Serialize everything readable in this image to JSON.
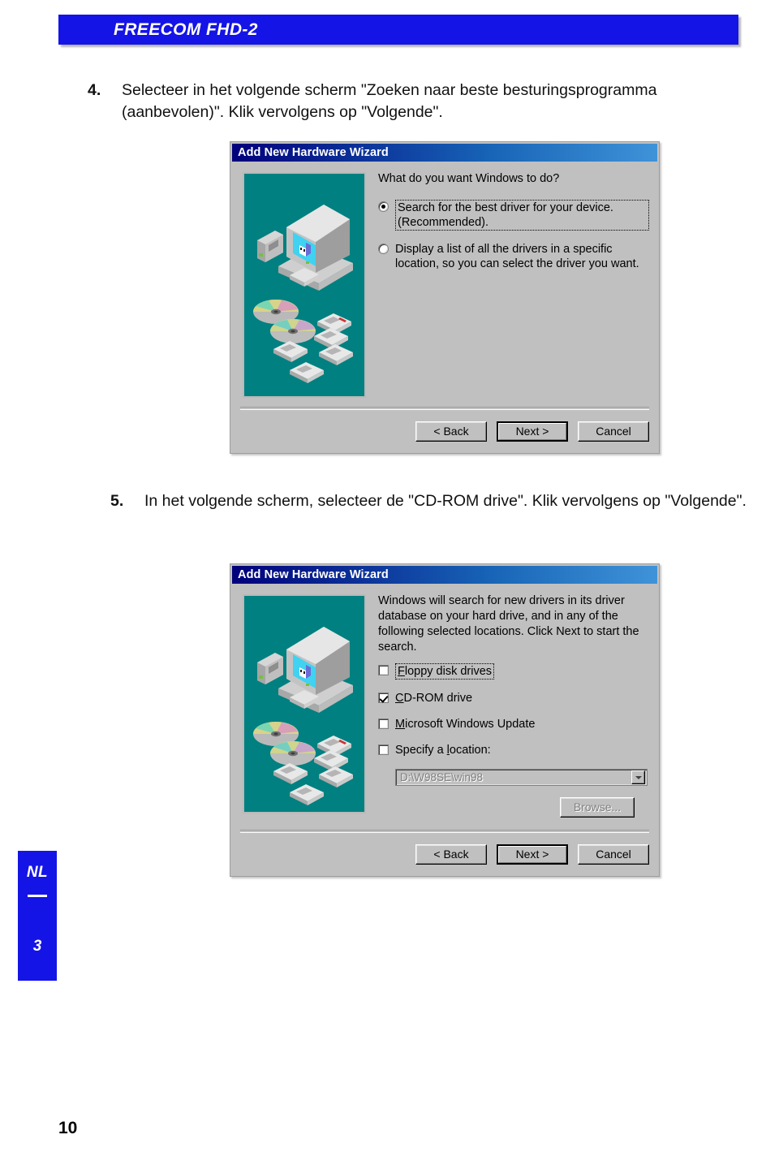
{
  "header": {
    "title": "FREECOM FHD-2"
  },
  "side_tab": {
    "language": "NL",
    "section": "3"
  },
  "page_number": "10",
  "steps": [
    {
      "number": "4.",
      "text": "Selecteer in het volgende scherm \"Zoeken naar beste besturingsprogramma (aanbevolen)\". Klik vervolgens op \"Volgende\"."
    },
    {
      "number": "5.",
      "text": "In het volgende scherm, selecteer de \"CD-ROM drive\". Klik vervolgens op \"Volgende\"."
    }
  ],
  "dialog1": {
    "title": "Add New Hardware Wizard",
    "prompt": "What do you want Windows to do?",
    "options": [
      {
        "label": "Search for the best driver for your device. (Recommended).",
        "selected": true,
        "focused": true
      },
      {
        "label": "Display a list of all the drivers in a specific location, so you can select the driver you want.",
        "selected": false,
        "focused": false
      }
    ],
    "buttons": {
      "back": "< Back",
      "back_mnemonic": "B",
      "next": "Next >",
      "cancel": "Cancel"
    }
  },
  "dialog2": {
    "title": "Add New Hardware Wizard",
    "prompt": "Windows will search for new drivers in its driver database on your hard drive, and in any of the following selected locations. Click Next to start the search.",
    "checkboxes": [
      {
        "label": "Floppy disk drives",
        "mnemonic": "F",
        "checked": false,
        "focused": true
      },
      {
        "label": "CD-ROM drive",
        "mnemonic": "C",
        "checked": true,
        "focused": false
      },
      {
        "label": "Microsoft Windows Update",
        "mnemonic": "M",
        "checked": false,
        "focused": false
      },
      {
        "label": "Specify a location:",
        "mnemonic": "l",
        "checked": false,
        "focused": false
      }
    ],
    "location": {
      "value": "D:\\W98SE\\win98",
      "browse_label": "Browse...",
      "browse_disabled": true
    },
    "buttons": {
      "back": "< Back",
      "back_mnemonic": "B",
      "next": "Next >",
      "cancel": "Cancel"
    }
  },
  "colors": {
    "brand_blue": "#1414e6",
    "dialog_face": "#c0c0c0",
    "illustration_bg": "#008080",
    "titlebar_start": "#00007b",
    "titlebar_end": "#3f93d8"
  }
}
